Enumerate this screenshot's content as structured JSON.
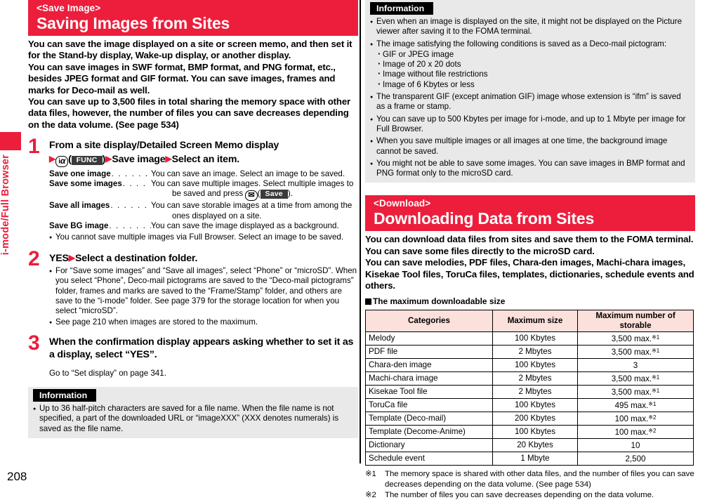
{
  "side_tab": {
    "label": "i-mode/Full Browser"
  },
  "page_number": "208",
  "left": {
    "section": {
      "kicker": "<Save Image>",
      "title": "Saving Images from Sites"
    },
    "intro": [
      "You can save the image displayed on a site or screen memo, and then set it for the Stand-by display, Wake-up display, or another display.",
      "You can save images in SWF format, BMP format, and PNG format, etc., besides JPEG format and GIF format. You can save images, frames and marks for Deco-mail as well.",
      "You can save up to 3,500 files in total sharing the memory space with other data files, however, the number of files you can save decreases depending on the data volume. (See page 534)"
    ],
    "steps": [
      {
        "num": "1",
        "head_line1": "From a site display/Detailed Screen Memo display",
        "key_i": "i",
        "key_alpha": "α",
        "softkey_func": "FUNC",
        "head_part2": "Save image",
        "head_part3": "Select an item.",
        "defs": [
          {
            "term": "Save one image",
            "desc": "You can save an image. Select an image to be saved.",
            "cont": ""
          },
          {
            "term": "Save some images",
            "desc": "You can save multiple images. Select multiple images to",
            "cont_pre": "be saved and press ",
            "cont_post": ").",
            "softkey": "Save"
          },
          {
            "term": "Save all images",
            "desc": "You can save storable images at a time from among the",
            "cont": "ones displayed on a site."
          },
          {
            "term": "Save BG image",
            "desc": "You can save the image displayed as a background.",
            "cont": ""
          }
        ],
        "bullets": [
          "You cannot save multiple images via Full Browser. Select an image to be saved."
        ]
      },
      {
        "num": "2",
        "head": "YES",
        "head2": "Select a destination folder.",
        "bullets": [
          "For “Save some images” and “Save all images”, select “Phone” or “microSD”. When you select “Phone”, Deco-mail pictograms are saved to the “Deco-mail pictograms” folder, frames and marks are saved to the “Frame/Stamp” folder, and others are save to the “i-mode” folder. See page 379 for the storage location for when you select “microSD”.",
          "See page 210 when images are stored to the maximum."
        ]
      },
      {
        "num": "3",
        "head": "When the confirmation display appears asking whether to set it as a display, select “YES”.",
        "goto": "Go to “Set display” on page 341."
      }
    ],
    "information": {
      "badge": "Information",
      "items": [
        "Up to 36 half-pitch characters are saved for a file name. When the file name is not specified, a part of the downloaded URL or “imageXXX” (XXX denotes numerals) is saved as the file name."
      ]
    }
  },
  "right": {
    "information": {
      "badge": "Information",
      "items": [
        "Even when an image is displayed on the site, it might not be displayed on the Picture viewer after saving it to the FOMA terminal.",
        "The image satisfying the following conditions is saved as a Deco-mail pictogram:",
        "The transparent GIF (except animation GIF) image whose extension is “ifm” is saved as a frame or stamp.",
        "You can save up to 500 Kbytes per image for i-mode, and up to 1 Mbyte per image for Full Browser.",
        "When you save multiple images or all images at one time, the background image cannot be saved.",
        "You might not be able to save some images. You can save images in BMP format and PNG format only to the microSD card."
      ],
      "conditions": [
        "GIF or JPEG image",
        "Image of 20 x 20 dots",
        "Image without file restrictions",
        "Image of 6 Kbytes or less"
      ]
    },
    "section": {
      "kicker": "<Download>",
      "title": "Downloading Data from Sites"
    },
    "intro": [
      "You can download data files from sites and save them to the FOMA terminal. You can save some files directly to the microSD card.",
      "You can save melodies, PDF files, Chara-den images, Machi-chara images, Kisekae Tool files, ToruCa files, templates, dictionaries, schedule events and others."
    ],
    "table_heading": "The maximum downloadable size",
    "table": {
      "headers": [
        "Categories",
        "Maximum size",
        "Maximum number of storable"
      ],
      "rows": [
        {
          "cat": "Melody",
          "size": "100 Kbytes",
          "num": "3,500 max.",
          "note": "※1"
        },
        {
          "cat": "PDF file",
          "size": "2 Mbytes",
          "num": "3,500 max.",
          "note": "※1"
        },
        {
          "cat": "Chara-den image",
          "size": "100 Kbytes",
          "num": "3",
          "note": ""
        },
        {
          "cat": "Machi-chara image",
          "size": "2 Mbytes",
          "num": "3,500 max.",
          "note": "※1"
        },
        {
          "cat": "Kisekae Tool file",
          "size": "2 Mbytes",
          "num": "3,500 max.",
          "note": "※1"
        },
        {
          "cat": "ToruCa file",
          "size": "100 Kbytes",
          "num": "495 max.",
          "note": "※1"
        },
        {
          "cat": "Template (Deco-mail)",
          "size": "200 Kbytes",
          "num": "100 max.",
          "note": "※2"
        },
        {
          "cat": "Template (Decome-Anime)",
          "size": "100 Kbytes",
          "num": "100 max.",
          "note": "※2"
        },
        {
          "cat": "Dictionary",
          "size": "20 Kbytes",
          "num": "10",
          "note": ""
        },
        {
          "cat": "Schedule event",
          "size": "1 Mbyte",
          "num": "2,500",
          "note": ""
        }
      ]
    },
    "footnotes": [
      {
        "mark": "※1",
        "text": "The memory space is shared with other data files, and the number of files you can save decreases depending on the data volume. (See page 534)"
      },
      {
        "mark": "※2",
        "text": "The number of files you can save decreases depending on the data volume."
      }
    ]
  }
}
